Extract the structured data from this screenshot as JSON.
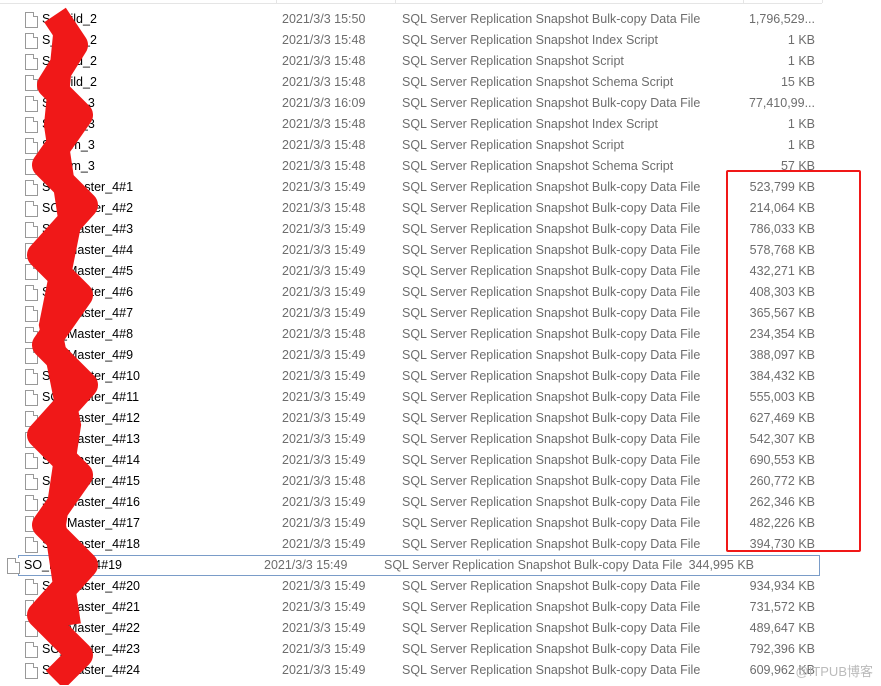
{
  "files": [
    {
      "name": "S_child_2",
      "date": "2021/3/3 15:50",
      "type": "SQL Server Replication Snapshot Bulk-copy Data File",
      "size": "1,796,529..."
    },
    {
      "name": "S_child_2",
      "date": "2021/3/3 15:48",
      "type": "SQL Server Replication Snapshot Index Script",
      "size": "1 KB"
    },
    {
      "name": "S_child_2",
      "date": "2021/3/3 15:48",
      "type": "SQL Server Replication Snapshot Script",
      "size": "1 KB"
    },
    {
      "name": "S_child_2",
      "date": "2021/3/3 15:48",
      "type": "SQL Server Replication Snapshot Schema Script",
      "size": "15 KB"
    },
    {
      "name": "S_item_3",
      "date": "2021/3/3 16:09",
      "type": "SQL Server Replication Snapshot Bulk-copy Data File",
      "size": "77,410,99..."
    },
    {
      "name": "S_item_3",
      "date": "2021/3/3 15:48",
      "type": "SQL Server Replication Snapshot Index Script",
      "size": "1 KB"
    },
    {
      "name": "S_item_3",
      "date": "2021/3/3 15:48",
      "type": "SQL Server Replication Snapshot Script",
      "size": "1 KB"
    },
    {
      "name": "S_item_3",
      "date": "2021/3/3 15:48",
      "type": "SQL Server Replication Snapshot Schema Script",
      "size": "57 KB"
    },
    {
      "name": "SO_Master_4#1",
      "date": "2021/3/3 15:49",
      "type": "SQL Server Replication Snapshot Bulk-copy Data File",
      "size": "523,799 KB"
    },
    {
      "name": "SO_Master_4#2",
      "date": "2021/3/3 15:48",
      "type": "SQL Server Replication Snapshot Bulk-copy Data File",
      "size": "214,064 KB"
    },
    {
      "name": "SO_Master_4#3",
      "date": "2021/3/3 15:49",
      "type": "SQL Server Replication Snapshot Bulk-copy Data File",
      "size": "786,033 KB"
    },
    {
      "name": "SO_Master_4#4",
      "date": "2021/3/3 15:49",
      "type": "SQL Server Replication Snapshot Bulk-copy Data File",
      "size": "578,768 KB"
    },
    {
      "name": "SO_Master_4#5",
      "date": "2021/3/3 15:49",
      "type": "SQL Server Replication Snapshot Bulk-copy Data File",
      "size": "432,271 KB"
    },
    {
      "name": "SO_Master_4#6",
      "date": "2021/3/3 15:49",
      "type": "SQL Server Replication Snapshot Bulk-copy Data File",
      "size": "408,303 KB"
    },
    {
      "name": "SO_Master_4#7",
      "date": "2021/3/3 15:49",
      "type": "SQL Server Replication Snapshot Bulk-copy Data File",
      "size": "365,567 KB"
    },
    {
      "name": "SO_Master_4#8",
      "date": "2021/3/3 15:48",
      "type": "SQL Server Replication Snapshot Bulk-copy Data File",
      "size": "234,354 KB"
    },
    {
      "name": "SO_Master_4#9",
      "date": "2021/3/3 15:49",
      "type": "SQL Server Replication Snapshot Bulk-copy Data File",
      "size": "388,097 KB"
    },
    {
      "name": "SO_Master_4#10",
      "date": "2021/3/3 15:49",
      "type": "SQL Server Replication Snapshot Bulk-copy Data File",
      "size": "384,432 KB"
    },
    {
      "name": "SO_Master_4#11",
      "date": "2021/3/3 15:49",
      "type": "SQL Server Replication Snapshot Bulk-copy Data File",
      "size": "555,003 KB"
    },
    {
      "name": "SO_Master_4#12",
      "date": "2021/3/3 15:49",
      "type": "SQL Server Replication Snapshot Bulk-copy Data File",
      "size": "627,469 KB"
    },
    {
      "name": "SO_Master_4#13",
      "date": "2021/3/3 15:49",
      "type": "SQL Server Replication Snapshot Bulk-copy Data File",
      "size": "542,307 KB"
    },
    {
      "name": "SO_Master_4#14",
      "date": "2021/3/3 15:49",
      "type": "SQL Server Replication Snapshot Bulk-copy Data File",
      "size": "690,553 KB"
    },
    {
      "name": "SO_Master_4#15",
      "date": "2021/3/3 15:48",
      "type": "SQL Server Replication Snapshot Bulk-copy Data File",
      "size": "260,772 KB"
    },
    {
      "name": "SO_Master_4#16",
      "date": "2021/3/3 15:49",
      "type": "SQL Server Replication Snapshot Bulk-copy Data File",
      "size": "262,346 KB"
    },
    {
      "name": "SO_Master_4#17",
      "date": "2021/3/3 15:49",
      "type": "SQL Server Replication Snapshot Bulk-copy Data File",
      "size": "482,226 KB"
    },
    {
      "name": "SO_Master_4#18",
      "date": "2021/3/3 15:49",
      "type": "SQL Server Replication Snapshot Bulk-copy Data File",
      "size": "394,730 KB"
    },
    {
      "name": "SO_Master_4#19",
      "date": "2021/3/3 15:49",
      "type": "SQL Server Replication Snapshot Bulk-copy Data File",
      "size": "344,995 KB",
      "selected": true
    },
    {
      "name": "SO_Master_4#20",
      "date": "2021/3/3 15:49",
      "type": "SQL Server Replication Snapshot Bulk-copy Data File",
      "size": "934,934 KB"
    },
    {
      "name": "SO_Master_4#21",
      "date": "2021/3/3 15:49",
      "type": "SQL Server Replication Snapshot Bulk-copy Data File",
      "size": "731,572 KB"
    },
    {
      "name": "SO_Master_4#22",
      "date": "2021/3/3 15:49",
      "type": "SQL Server Replication Snapshot Bulk-copy Data File",
      "size": "489,647 KB"
    },
    {
      "name": "SO_Master_4#23",
      "date": "2021/3/3 15:49",
      "type": "SQL Server Replication Snapshot Bulk-copy Data File",
      "size": "792,396 KB"
    },
    {
      "name": "SO_Master_4#24",
      "date": "2021/3/3 15:49",
      "type": "SQL Server Replication Snapshot Bulk-copy Data File",
      "size": "609,962 KB"
    }
  ],
  "watermark": "@ITPUB博客",
  "colors": {
    "highlight": "#f01818",
    "selection": "#7a9cc8"
  }
}
